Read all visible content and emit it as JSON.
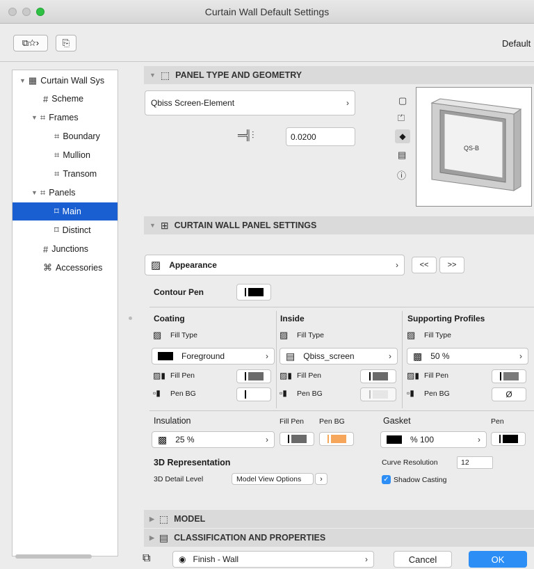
{
  "window": {
    "title": "Curtain Wall Default Settings",
    "default_label": "Default"
  },
  "sidebar": {
    "items": [
      {
        "label": "Curtain Wall Sys",
        "icon": "grid-icon",
        "arrow": "▼"
      },
      {
        "label": "Scheme",
        "icon": "scheme-icon"
      },
      {
        "label": "Frames",
        "icon": "frames-icon",
        "arrow": "▼"
      },
      {
        "label": "Boundary",
        "icon": "frame-icon"
      },
      {
        "label": "Mullion",
        "icon": "frame-icon"
      },
      {
        "label": "Transom",
        "icon": "frame-icon"
      },
      {
        "label": "Panels",
        "icon": "panels-icon",
        "arrow": "▼"
      },
      {
        "label": "Main",
        "icon": "panel-icon"
      },
      {
        "label": "Distinct",
        "icon": "panel-icon"
      },
      {
        "label": "Junctions",
        "icon": "junctions-icon"
      },
      {
        "label": "Accessories",
        "icon": "accessories-icon"
      }
    ]
  },
  "sections": {
    "panel_type": "PANEL TYPE AND GEOMETRY",
    "panel_settings": "CURTAIN WALL PANEL SETTINGS",
    "model": "MODEL",
    "classification": "CLASSIFICATION AND PROPERTIES"
  },
  "geometry": {
    "panel_type": "Qbiss Screen-Element",
    "thickness": "0.0200",
    "preview_label": "QS-B"
  },
  "settings": {
    "page": "Appearance",
    "prev": "<<",
    "next": ">>",
    "contour_pen": "Contour Pen",
    "coating": {
      "title": "Coating",
      "fill_type": "Fill Type",
      "fill": "Foreground",
      "fill_pen": "Fill Pen",
      "pen_bg": "Pen BG"
    },
    "inside": {
      "title": "Inside",
      "fill_type": "Fill Type",
      "fill": "Qbiss_screen",
      "fill_pen": "Fill Pen",
      "pen_bg": "Pen BG"
    },
    "supporting": {
      "title": "Supporting Profiles",
      "fill_type": "Fill Type",
      "fill": "50 %",
      "fill_pen": "Fill Pen",
      "pen_bg": "Pen BG",
      "pen_bg_value": "Ø"
    },
    "insulation": {
      "title": "Insulation",
      "fill_pen": "Fill Pen",
      "pen_bg": "Pen BG",
      "fill": "25 %"
    },
    "gasket": {
      "title": "Gasket",
      "pen": "Pen",
      "fill": "% 100"
    },
    "rep": {
      "title": "3D Representation",
      "detail_label": "3D Detail Level",
      "detail_value": "Model View Options",
      "curve_label": "Curve Resolution",
      "curve_value": "12",
      "shadow_label": "Shadow Casting"
    }
  },
  "footer": {
    "layer": "Finish - Wall",
    "cancel": "Cancel",
    "ok": "OK"
  },
  "colors": {
    "accent": "#1a5fd1",
    "ok_button": "#2d8ff5",
    "orange": "#f5a65b"
  }
}
